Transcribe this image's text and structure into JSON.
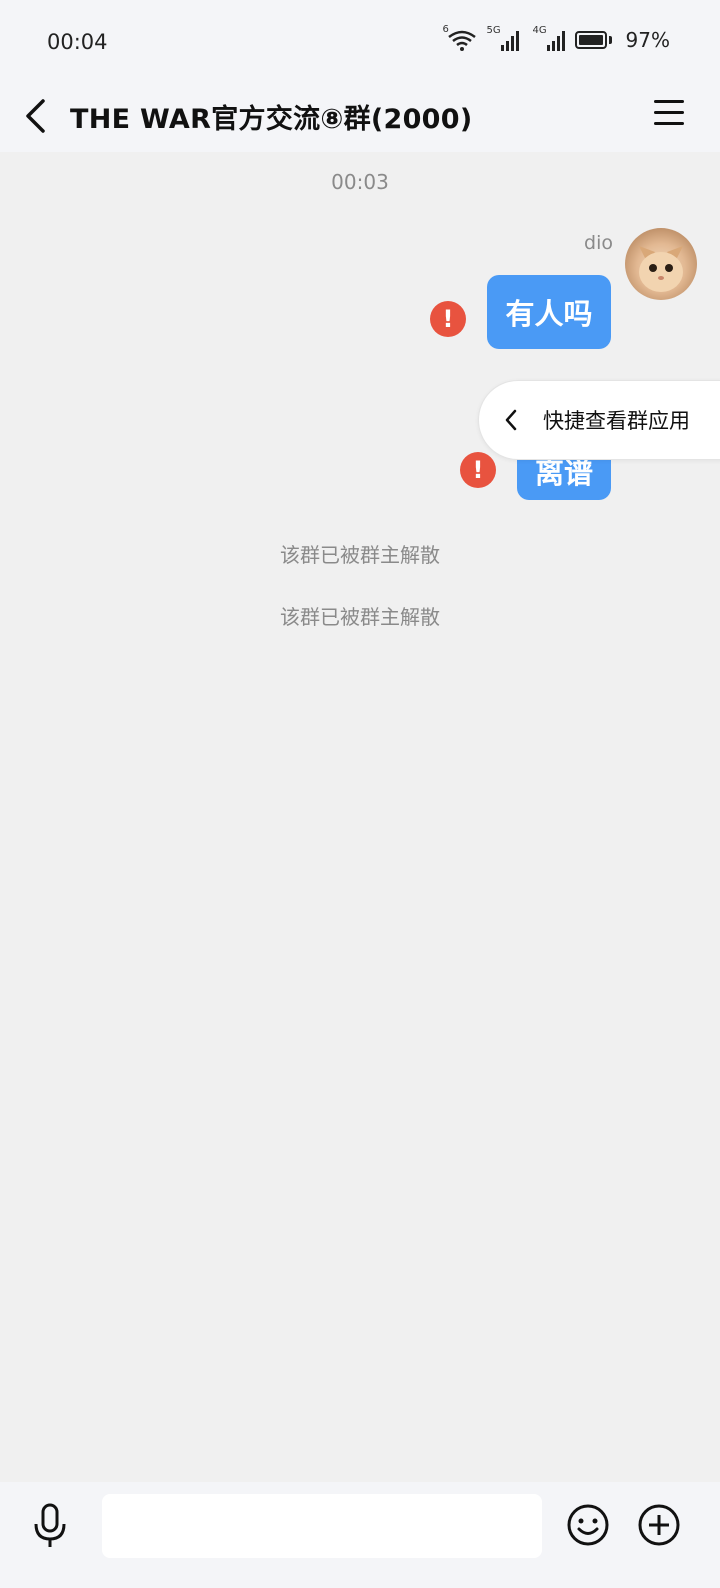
{
  "status_bar": {
    "time": "00:04",
    "wifi_tag": "6",
    "sim1_tag": "5G",
    "sim2_tag": "4G",
    "battery": "97%",
    "icons": [
      "wifi-icon",
      "signal-icon",
      "signal-icon",
      "battery-icon"
    ]
  },
  "header": {
    "back_icon": "chevron-left-icon",
    "title": "THE WAR官方交流⑧群(2000)",
    "menu_icon": "hamburger-menu-icon"
  },
  "chat": {
    "timestamp": "00:03",
    "sender_name": "dio",
    "messages": [
      {
        "text": "有人吗",
        "failed": true
      },
      {
        "text": "离谱",
        "failed": true
      }
    ],
    "error_glyph": "!",
    "system_messages": [
      "该群已被群主解散",
      "该群已被群主解散"
    ],
    "quick_panel": {
      "label": "快捷查看群应用",
      "icon": "chevron-left-icon"
    }
  },
  "input_bar": {
    "placeholder": "",
    "icons": [
      "microphone-icon",
      "emoji-icon",
      "plus-icon"
    ]
  },
  "colors": {
    "bubble": "#4a9af5",
    "error": "#e8533f",
    "background": "#f0f0f0",
    "header": "#f4f5f8"
  }
}
